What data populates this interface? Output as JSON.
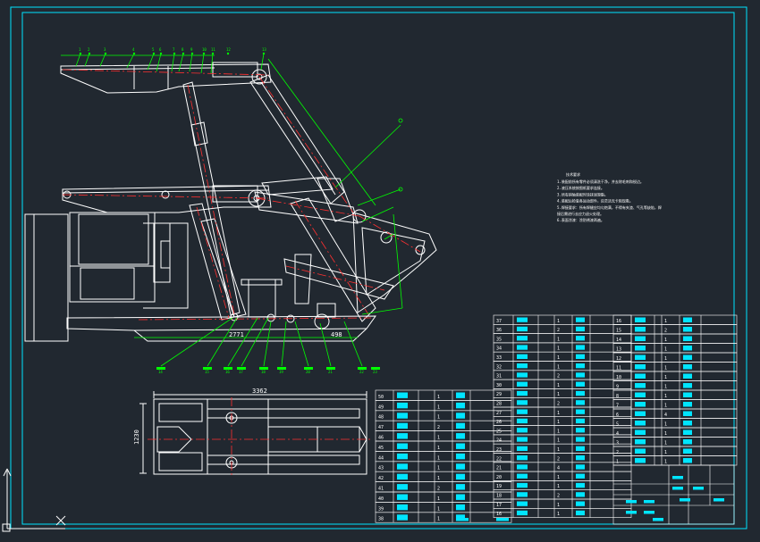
{
  "drawing": {
    "dimensions": {
      "base_length": "2771",
      "base_offset": "498",
      "plan_length": "3362",
      "plan_width": "1230"
    },
    "notes_title": "技术要求",
    "notes": [
      "1.装配前所有零件必须清洗干净，并去除毛刺和锐边。",
      "2.液压系统按图纸要求连接。",
      "3.所有销轴装配时涂抹润滑脂。",
      "4.装配后检查各运动部件，应灵活无卡阻现象。",
      "5.焊接要求：所有焊缝应均匀饱满，不得有夹渣、气孔等缺陷，焊",
      "接后需进行去应力退火处理。",
      "6.表面涂漆：涂防锈漆两遍。"
    ]
  },
  "parts_table": {
    "col_c": [
      {
        "no": "37",
        "qty": "1"
      },
      {
        "no": "36",
        "qty": "2"
      },
      {
        "no": "35",
        "qty": "1"
      },
      {
        "no": "34",
        "qty": "1"
      },
      {
        "no": "33",
        "qty": "1"
      },
      {
        "no": "32",
        "qty": "1"
      },
      {
        "no": "31",
        "qty": "2"
      },
      {
        "no": "30",
        "qty": "1"
      },
      {
        "no": "29",
        "qty": "1"
      },
      {
        "no": "28",
        "qty": "2"
      },
      {
        "no": "27",
        "qty": "1"
      },
      {
        "no": "26",
        "qty": "1"
      },
      {
        "no": "25",
        "qty": "1"
      },
      {
        "no": "24",
        "qty": "1"
      },
      {
        "no": "23",
        "qty": "1"
      },
      {
        "no": "22",
        "qty": "2"
      },
      {
        "no": "21",
        "qty": "4"
      },
      {
        "no": "20",
        "qty": "1"
      },
      {
        "no": "19",
        "qty": "1"
      },
      {
        "no": "18",
        "qty": "2"
      },
      {
        "no": "17",
        "qty": "1"
      },
      {
        "no": "16",
        "qty": "1"
      }
    ],
    "col_d": [
      {
        "no": "16",
        "qty": "1"
      },
      {
        "no": "15",
        "qty": "2"
      },
      {
        "no": "14",
        "qty": "1"
      },
      {
        "no": "13",
        "qty": "1"
      },
      {
        "no": "12",
        "qty": "1"
      },
      {
        "no": "11",
        "qty": "1"
      },
      {
        "no": "10",
        "qty": "1"
      },
      {
        "no": "9",
        "qty": "1"
      },
      {
        "no": "8",
        "qty": "1"
      },
      {
        "no": "7",
        "qty": "1"
      },
      {
        "no": "6",
        "qty": "4"
      },
      {
        "no": "5",
        "qty": "1"
      },
      {
        "no": "4",
        "qty": "1"
      },
      {
        "no": "3",
        "qty": "1"
      },
      {
        "no": "2",
        "qty": "1"
      },
      {
        "no": "1",
        "qty": "1"
      }
    ],
    "col_a": [
      {
        "no": "50",
        "qty": "1"
      },
      {
        "no": "49",
        "qty": "1"
      },
      {
        "no": "48",
        "qty": "1"
      },
      {
        "no": "47",
        "qty": "2"
      },
      {
        "no": "46",
        "qty": "1"
      },
      {
        "no": "45",
        "qty": "1"
      },
      {
        "no": "44",
        "qty": "1"
      },
      {
        "no": "43",
        "qty": "1"
      },
      {
        "no": "42",
        "qty": "1"
      },
      {
        "no": "41",
        "qty": "2"
      },
      {
        "no": "40",
        "qty": "1"
      },
      {
        "no": "39",
        "qty": "1"
      },
      {
        "no": "38",
        "qty": "1"
      }
    ]
  },
  "callouts_top": [
    "1",
    "2",
    "3",
    "4",
    "5",
    "6",
    "7",
    "8",
    "9",
    "10",
    "11",
    "12",
    "13"
  ],
  "callouts_bottom": [
    "14",
    "15",
    "16",
    "17",
    "18",
    "19",
    "20",
    "21",
    "22",
    "23"
  ],
  "colors": {
    "background": "#212830",
    "frame": "#00e5ff",
    "outline": "#ffffff",
    "leader": "#00ff00",
    "centerline": "#ff3030",
    "table_fill": "#00e5ff"
  }
}
